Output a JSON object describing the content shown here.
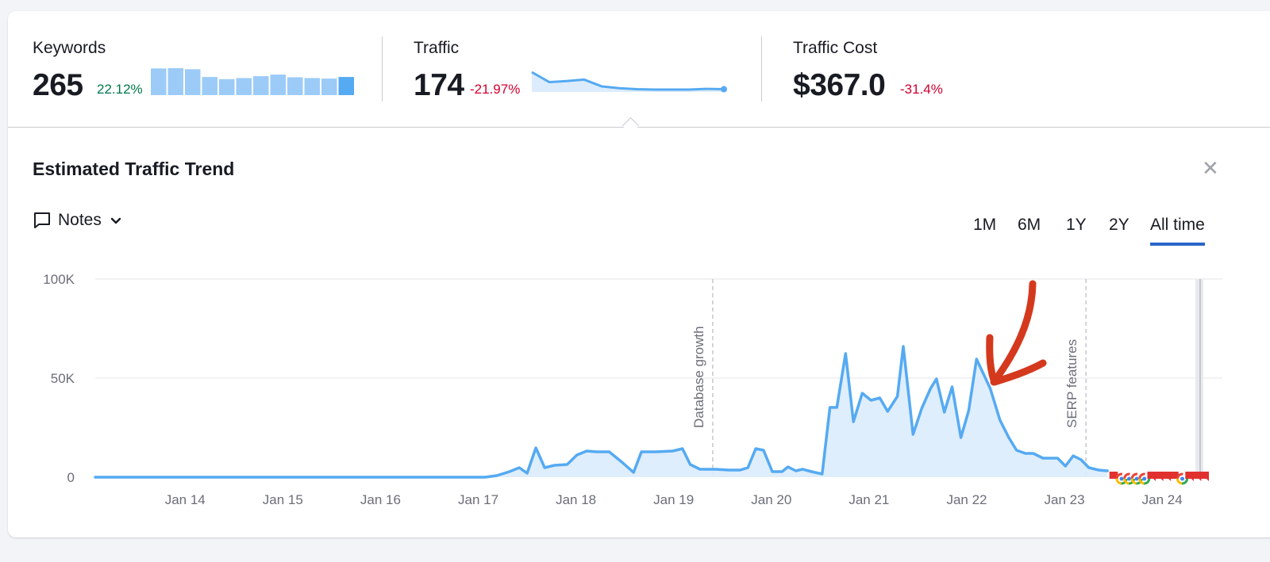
{
  "metrics": [
    {
      "label": "Keywords",
      "value": "265",
      "delta": "22.12%",
      "delta_sign": "positive",
      "sparkline_type": "bar",
      "sparkline_values": [
        100,
        101,
        97,
        68,
        60,
        64,
        71,
        77,
        67,
        64,
        62,
        68
      ]
    },
    {
      "label": "Traffic",
      "value": "174",
      "delta": "-21.97%",
      "delta_sign": "negative",
      "sparkline_type": "area",
      "sparkline_values": [
        100,
        72,
        75,
        79,
        60,
        55,
        52,
        51,
        51,
        51,
        53,
        52
      ]
    },
    {
      "label": "Traffic Cost",
      "value": "$367.0",
      "delta": "-31.4%",
      "delta_sign": "negative"
    }
  ],
  "panel": {
    "title": "Estimated Traffic Trend",
    "close_icon": "close-icon",
    "notes_label": "Notes",
    "notes_icon": "comment-icon",
    "notes_dropdown_icon": "chevron-down-icon"
  },
  "ranges": [
    {
      "label": "1M",
      "active": false
    },
    {
      "label": "6M",
      "active": false
    },
    {
      "label": "1Y",
      "active": false
    },
    {
      "label": "2Y",
      "active": false
    },
    {
      "label": "All time",
      "active": true
    }
  ],
  "colors": {
    "line": "#55aaf2",
    "fill": "#dcecfc",
    "positive": "#00794a",
    "negative": "#d1002f",
    "active_tab": "#2a65c8",
    "annotation_arrow": "#d4391e",
    "flag_red": "#e0312f"
  },
  "chart_data": {
    "type": "area",
    "title": "Estimated Traffic Trend",
    "xlabel": "",
    "ylabel": "",
    "ylim": [
      0,
      100000
    ],
    "xlim": [
      2013.08,
      2024.47
    ],
    "y_ticks": [
      {
        "value": 0,
        "label": "0"
      },
      {
        "value": 50000,
        "label": "50K"
      },
      {
        "value": 100000,
        "label": "100K"
      }
    ],
    "x_ticks": [
      {
        "value": 2014,
        "label": "Jan 14"
      },
      {
        "value": 2015,
        "label": "Jan 15"
      },
      {
        "value": 2016,
        "label": "Jan 16"
      },
      {
        "value": 2017,
        "label": "Jan 17"
      },
      {
        "value": 2018,
        "label": "Jan 18"
      },
      {
        "value": 2019,
        "label": "Jan 19"
      },
      {
        "value": 2020,
        "label": "Jan 20"
      },
      {
        "value": 2021,
        "label": "Jan 21"
      },
      {
        "value": 2022,
        "label": "Jan 22"
      },
      {
        "value": 2023,
        "label": "Jan 23"
      },
      {
        "value": 2024,
        "label": "Jan 24"
      }
    ],
    "grid": true,
    "annotations": [
      {
        "x": 2019.4,
        "label": "Database growth"
      },
      {
        "x": 2023.22,
        "label": "SERP features"
      }
    ],
    "series": [
      {
        "name": "Traffic",
        "points": [
          [
            2013.08,
            0
          ],
          [
            2017.07,
            0
          ],
          [
            2017.19,
            800
          ],
          [
            2017.32,
            2800
          ],
          [
            2017.42,
            4800
          ],
          [
            2017.5,
            2000
          ],
          [
            2017.59,
            14800
          ],
          [
            2017.68,
            4800
          ],
          [
            2017.78,
            6000
          ],
          [
            2017.91,
            6400
          ],
          [
            2018.01,
            11200
          ],
          [
            2018.11,
            13200
          ],
          [
            2018.21,
            12800
          ],
          [
            2018.34,
            12800
          ],
          [
            2018.47,
            7600
          ],
          [
            2018.59,
            2400
          ],
          [
            2018.67,
            12800
          ],
          [
            2018.82,
            12800
          ],
          [
            2018.99,
            13200
          ],
          [
            2019.09,
            14400
          ],
          [
            2019.17,
            6400
          ],
          [
            2019.27,
            4000
          ],
          [
            2019.43,
            4000
          ],
          [
            2019.56,
            3600
          ],
          [
            2019.68,
            3600
          ],
          [
            2019.76,
            4800
          ],
          [
            2019.84,
            14400
          ],
          [
            2019.92,
            13600
          ],
          [
            2020.01,
            2800
          ],
          [
            2020.11,
            2800
          ],
          [
            2020.17,
            5200
          ],
          [
            2020.25,
            3200
          ],
          [
            2020.32,
            4000
          ],
          [
            2020.41,
            2800
          ],
          [
            2020.52,
            1600
          ],
          [
            2020.6,
            35200
          ],
          [
            2020.67,
            35200
          ],
          [
            2020.76,
            62400
          ],
          [
            2020.84,
            28000
          ],
          [
            2020.93,
            42400
          ],
          [
            2021.02,
            38800
          ],
          [
            2021.11,
            40000
          ],
          [
            2021.19,
            33200
          ],
          [
            2021.29,
            40800
          ],
          [
            2021.35,
            66000
          ],
          [
            2021.45,
            21600
          ],
          [
            2021.54,
            34800
          ],
          [
            2021.63,
            44800
          ],
          [
            2021.69,
            49600
          ],
          [
            2021.77,
            32800
          ],
          [
            2021.85,
            45600
          ],
          [
            2021.94,
            20000
          ],
          [
            2022.02,
            33600
          ],
          [
            2022.1,
            59600
          ],
          [
            2022.24,
            44800
          ],
          [
            2022.34,
            28800
          ],
          [
            2022.43,
            20000
          ],
          [
            2022.51,
            13600
          ],
          [
            2022.6,
            12000
          ],
          [
            2022.68,
            12000
          ],
          [
            2022.78,
            9600
          ],
          [
            2022.85,
            9600
          ],
          [
            2022.93,
            9600
          ],
          [
            2023.01,
            5600
          ],
          [
            2023.09,
            10800
          ],
          [
            2023.17,
            8800
          ],
          [
            2023.25,
            4800
          ],
          [
            2023.35,
            3600
          ],
          [
            2023.44,
            3200
          ]
        ]
      }
    ],
    "markers": {
      "position": "bottom",
      "start_x": 2023.46,
      "end_x": 2024.47,
      "items": [
        "flag",
        "google",
        "google",
        "google",
        "google",
        "flag",
        "flag",
        "flag",
        "flag",
        "google",
        "flag",
        "flag",
        "flag"
      ]
    },
    "highlight_arrow": {
      "label": "",
      "points_to_x": 2022.3
    }
  }
}
